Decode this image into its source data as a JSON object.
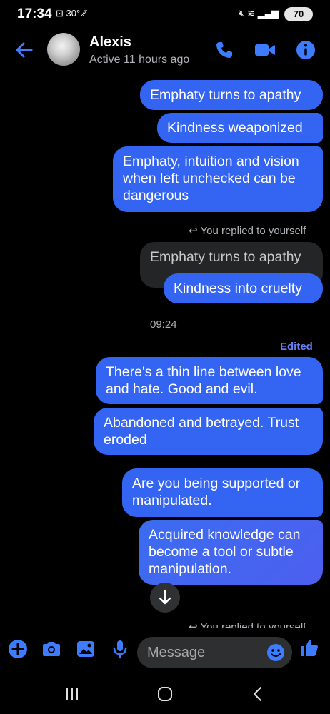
{
  "status_bar": {
    "time": "17:34",
    "temp": "30°",
    "battery": "70",
    "left_icons": [
      "screenshot-icon",
      "temperature-icon",
      "signal-off-icon"
    ],
    "right_icons": [
      "mute-icon",
      "wifi-icon",
      "signal-icon",
      "signal-icon"
    ]
  },
  "header": {
    "name": "Alexis",
    "status": "Active 11 hours ago"
  },
  "messages": {
    "m1": "Emphaty turns to apathy",
    "m2": "Kindness weaponized",
    "m3": "Emphaty, intuition and vision when left unchecked can be dangerous",
    "reply_note": "You replied to yourself",
    "quoted": "Emphaty turns to apathy",
    "m4": "Kindness into cruelty",
    "timestamp": "09:24",
    "edited": "Edited",
    "m5": "There's a thin line between love and hate. Good and evil.",
    "m6": "Abandoned and betrayed. Trust eroded",
    "m7": "Are you being supported or manipulated.",
    "m8": "Acquired knowledge can become a tool or subtle manipulation.",
    "reply_note_2": "You replied to yourself"
  },
  "composer": {
    "placeholder": "Message"
  },
  "colors": {
    "accent": "#3364f2",
    "bubble_gray": "#242526",
    "background": "#000000"
  }
}
